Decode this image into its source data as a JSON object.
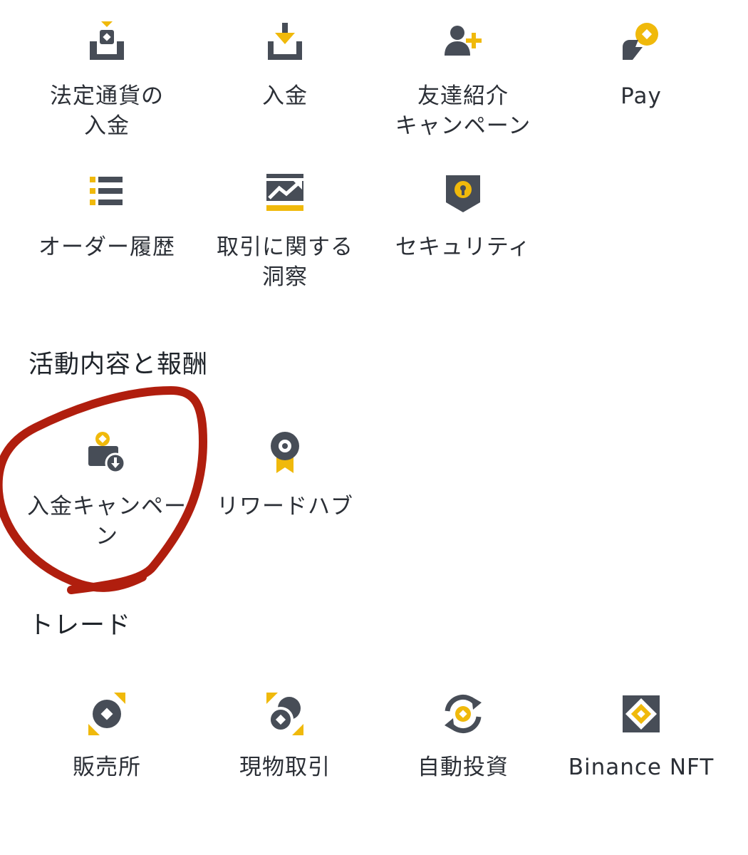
{
  "colors": {
    "accent": "#F0B90B",
    "icon_dark": "#474D57",
    "text": "#2B2F36",
    "annotation_red": "#B01E0E"
  },
  "top_grid": {
    "items": [
      {
        "label": "法定通貨の\n入金",
        "icon": "fiat-deposit-icon"
      },
      {
        "label": "入金",
        "icon": "deposit-icon"
      },
      {
        "label": "友達紹介\nキャンペーン",
        "icon": "add-friend-icon"
      },
      {
        "label": "Pay",
        "icon": "pay-icon"
      },
      {
        "label": "オーダー履歴",
        "icon": "order-list-icon"
      },
      {
        "label": "取引に関する\n洞察",
        "icon": "trade-chart-icon"
      },
      {
        "label": "セキュリティ",
        "icon": "shield-lock-icon"
      }
    ]
  },
  "activities": {
    "title": "活動内容と報酬",
    "items": [
      {
        "label": "入金キャンペー\nン",
        "icon": "deposit-campaign-icon"
      },
      {
        "label": "リワードハブ",
        "icon": "reward-badge-icon"
      }
    ]
  },
  "trade": {
    "title": "トレード",
    "items": [
      {
        "label": "販売所",
        "icon": "convert-icon"
      },
      {
        "label": "現物取引",
        "icon": "spot-trade-icon"
      },
      {
        "label": "自動投資",
        "icon": "auto-invest-icon"
      },
      {
        "label": "Binance NFT",
        "icon": "nft-icon"
      }
    ]
  }
}
